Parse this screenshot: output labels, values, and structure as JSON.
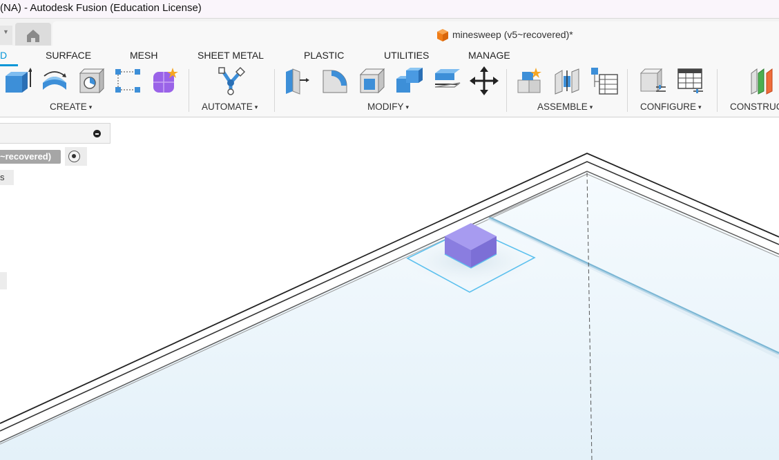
{
  "window": {
    "title": "(NA) - Autodesk Fusion (Education License)"
  },
  "document": {
    "title": "minesweep (v5~recovered)*"
  },
  "ribbon": {
    "tabs": [
      {
        "label": "D",
        "active": true
      },
      {
        "label": "SURFACE"
      },
      {
        "label": "MESH"
      },
      {
        "label": "SHEET METAL"
      },
      {
        "label": "PLASTIC"
      },
      {
        "label": "UTILITIES"
      },
      {
        "label": "MANAGE"
      }
    ],
    "groups": {
      "create": "CREATE",
      "automate": "AUTOMATE",
      "modify": "MODIFY",
      "assemble": "ASSEMBLE",
      "configure": "CONFIGURE",
      "construct": "CONSTRUC"
    },
    "dropdown_glyph": "▾"
  },
  "browser": {
    "root_label": "~recovered)",
    "child_label": "s"
  },
  "colors": {
    "accent": "#0696d7",
    "tool_blue": "#4a90d9",
    "body_purple": "#8a7de0",
    "sketch_cyan": "#6cc4ec"
  }
}
